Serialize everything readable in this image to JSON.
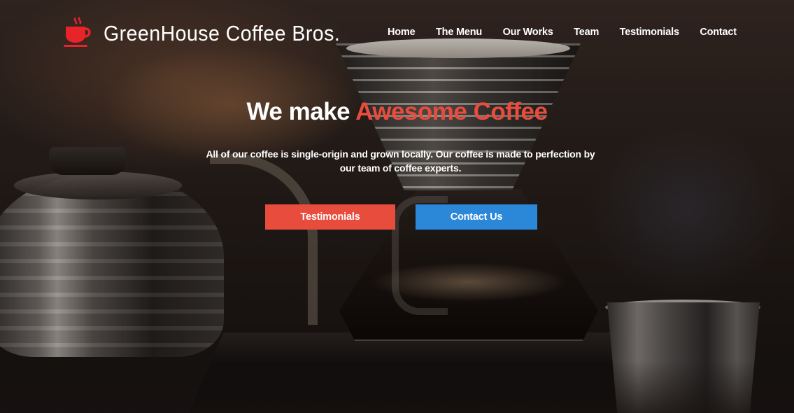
{
  "brand": {
    "name": "GreenHouse Coffee Bros.",
    "logo_icon": "coffee-cup-icon",
    "logo_color": "#e8232a"
  },
  "nav": {
    "items": [
      "Home",
      "The Menu",
      "Our Works",
      "Team",
      "Testimonials",
      "Contact"
    ]
  },
  "hero": {
    "title_prefix": "We make ",
    "title_accent": "Awesome Coffee",
    "subtitle": "All of our coffee is single-origin and grown locally. Our coffee is made to perfection by our team of coffee experts.",
    "primary_button": "Testimonials",
    "secondary_button": "Contact Us"
  },
  "colors": {
    "accent_red": "#e84c3d",
    "accent_blue": "#2b87d8",
    "text": "#ffffff"
  }
}
